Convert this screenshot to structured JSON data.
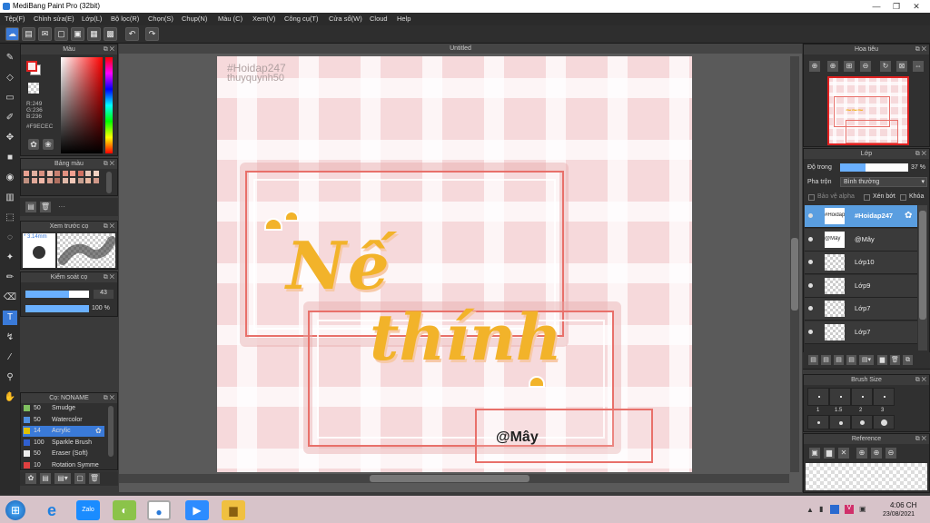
{
  "window": {
    "title": "MediBang Paint Pro (32bit)",
    "minimize": "—",
    "maximize": "❐",
    "close": "✕"
  },
  "menu": [
    "Tệp(F)",
    "Chỉnh sửa(E)",
    "Lớp(L)",
    "Bộ lọc(R)",
    "Chọn(S)",
    "Chụp(N)",
    "Màu (C)",
    "Xem(V)",
    "Công cụ(T)",
    "Cửa sổ(W)",
    "Cloud",
    "Help"
  ],
  "color_panel": {
    "title": "Màu",
    "r": "R:249",
    "g": "G:236",
    "b": "B:236",
    "hex": "#F9ECEC",
    "fg": "#f9ecec",
    "accent": "#e02020"
  },
  "palette_panel": {
    "title": "Bảng màu",
    "more": "···",
    "swatches": [
      "#e8a090",
      "#e0b0a0",
      "#d89080",
      "#f0c0b0",
      "#c88070",
      "#e09080",
      "#f0a090",
      "#d07060",
      "#e8c8b8",
      "#f0d0c0",
      "#c09080",
      "#e0a898",
      "#f0b8a8",
      "#d8a090",
      "#b07060",
      "#e0b8a8",
      "#f0c8b8",
      "#c8a090",
      "#e8b8a0",
      "#d09888"
    ]
  },
  "preview_panel": {
    "title": "Xem trước cọ",
    "size": "* 3.14mm"
  },
  "brush_control": {
    "title": "Kiểm soát cọ",
    "size_value": "43",
    "opacity_value": "100 %"
  },
  "brush_list": {
    "title": "Cọ: NONAME",
    "items": [
      {
        "num": "50",
        "name": "Smudge",
        "color": "#80c060"
      },
      {
        "num": "50",
        "name": "Watercolor",
        "color": "#5090e0"
      },
      {
        "num": "14",
        "name": "Acrylic",
        "color": "#e0c000",
        "selected": true
      },
      {
        "num": "100",
        "name": "Sparkle Brush",
        "color": "#3060d0"
      },
      {
        "num": "50",
        "name": "Eraser (Soft)",
        "color": "#eeeeee"
      },
      {
        "num": "10",
        "name": "Rotation Symme",
        "color": "#e04040"
      }
    ]
  },
  "canvas": {
    "tab_title": "Untitled",
    "watermark_1": "#Hoidap247",
    "watermark_2": "thuyquynh50",
    "word_1": "Nế",
    "word_2": "thính",
    "tag": "@Mây"
  },
  "navigator": {
    "title": "Hoa tiêu"
  },
  "layers_panel": {
    "title": "Lớp",
    "opacity_label": "Độ trong",
    "opacity_value": "37 %",
    "opacity_fraction": 0.37,
    "blend_label": "Pha trộn",
    "blend_value": "Bình thường",
    "protect_alpha": "Bảo vệ alpha",
    "clipping": "Xén bớt",
    "lock": "Khóa",
    "layers": [
      {
        "name": "#Hoidap247",
        "thumb": "#Hoidap247",
        "selected": true
      },
      {
        "name": "@Mây",
        "thumb": "@Mây",
        "selected": false
      },
      {
        "name": "Lớp10",
        "thumb": "",
        "selected": false
      },
      {
        "name": "Lớp9",
        "thumb": "",
        "selected": false
      },
      {
        "name": "Lớp7",
        "thumb": "",
        "selected": false
      },
      {
        "name": "Lớp7",
        "thumb": "",
        "selected": false
      }
    ]
  },
  "brush_size_panel": {
    "title": "Brush Size",
    "sizes": [
      "1",
      "1.5",
      "2",
      "3"
    ]
  },
  "reference_panel": {
    "title": "Reference"
  },
  "taskbar": {
    "time": "4:06 CH",
    "date": "23/08/2021",
    "apps": [
      "start-icon",
      "ie-icon",
      "zalo-icon",
      "coccoc-icon",
      "medibang-icon",
      "zoom-icon",
      "explorer-icon"
    ],
    "zalo_label": "Zalo"
  }
}
